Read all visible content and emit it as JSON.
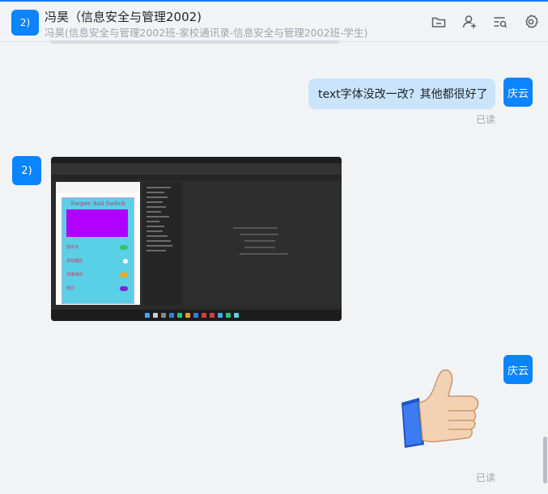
{
  "header": {
    "avatar_text": "2)",
    "title": "冯昊（信息安全与管理2002)",
    "subtitle": "冯昊(信息安全与管理2002班-家校通讯录-信息安全与管理2002班-学生)"
  },
  "toolbar": {
    "icons": [
      "folder-icon",
      "add-user-icon",
      "search-list-icon",
      "settings-icon"
    ]
  },
  "messages": [
    {
      "direction": "out",
      "avatar_text": "庆云",
      "text": "text字体没改一改？其他都很好了",
      "read_label": "已读"
    },
    {
      "direction": "in",
      "avatar_text": "2)",
      "type": "image",
      "image": {
        "title": "Swiper And Switch",
        "rows": [
          "指示点",
          "自动播放",
          "衔接滑动",
          "竖向"
        ]
      }
    },
    {
      "direction": "out",
      "avatar_text": "庆云",
      "type": "emoji",
      "emoji": "thumbs-up",
      "read_label": "已读"
    }
  ],
  "colors": {
    "accent": "#0a84ff",
    "out_bubble": "#c9e4fb",
    "background": "#f2f3f5"
  }
}
